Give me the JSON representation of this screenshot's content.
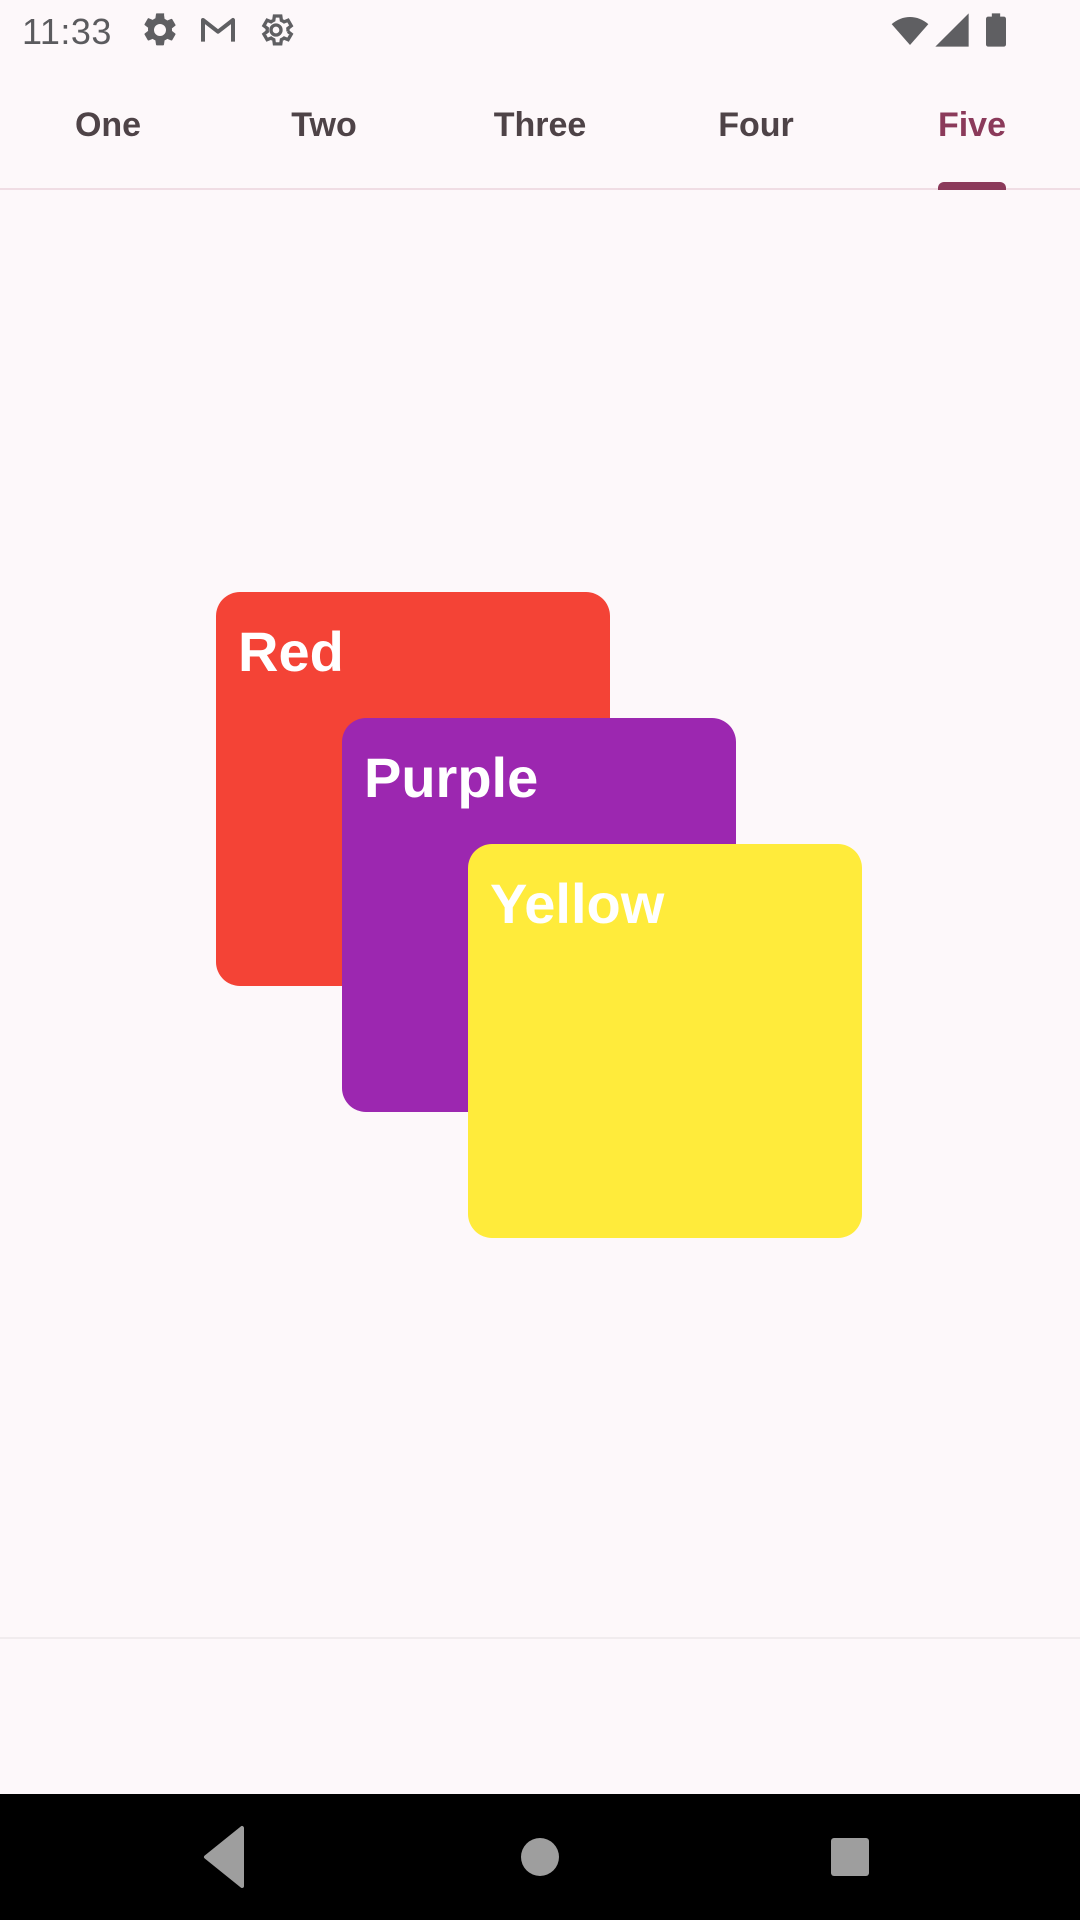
{
  "status_bar": {
    "time": "11:33",
    "icons": [
      "settings-icon",
      "gmail-icon",
      "settings-outline-icon",
      "wifi-icon",
      "signal-icon",
      "battery-icon"
    ]
  },
  "tabs": [
    {
      "label": "One",
      "active": false
    },
    {
      "label": "Two",
      "active": false
    },
    {
      "label": "Three",
      "active": false
    },
    {
      "label": "Four",
      "active": false
    },
    {
      "label": "Five",
      "active": true
    }
  ],
  "cards": [
    {
      "label": "Red",
      "color": "#f44336"
    },
    {
      "label": "Purple",
      "color": "#9c27b0"
    },
    {
      "label": "Yellow",
      "color": "#ffeb3b"
    }
  ],
  "colors": {
    "accent": "#8b3a5a",
    "tab_text": "#4e4347",
    "background": "#fdf8fa"
  },
  "nav_bar": {
    "buttons": [
      "back-icon",
      "home-icon",
      "recents-icon"
    ]
  }
}
